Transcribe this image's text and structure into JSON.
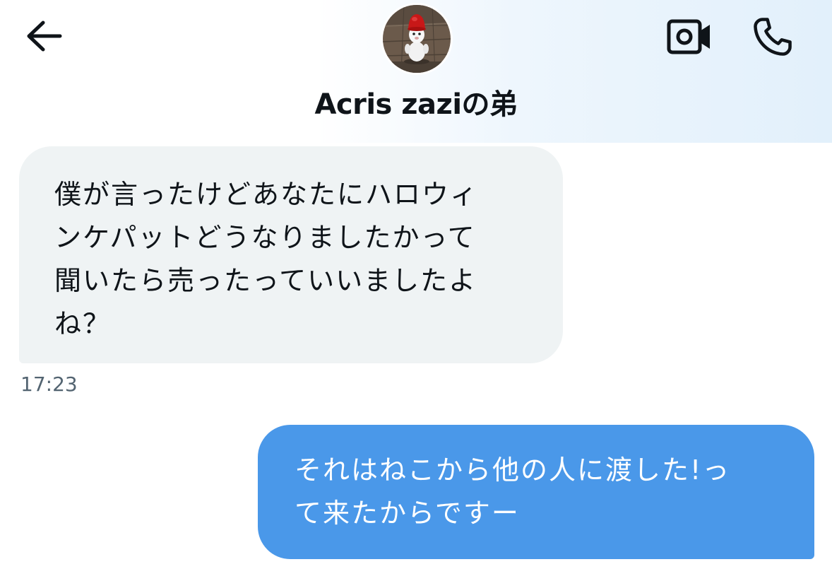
{
  "header": {
    "contact_name": "Acris zaziの弟",
    "back_icon": "arrow-left-icon",
    "video_icon": "video-camera-icon",
    "call_icon": "phone-icon"
  },
  "messages": [
    {
      "direction": "incoming",
      "text": "僕が言ったけどあなたにハロウィ\nンケパットどうなりましたかって\n聞いたら売ったっていいましたよ\nね？",
      "time": "17:23"
    },
    {
      "direction": "outgoing",
      "text": "それはねこから他の人に渡した!っ\nて来たからですー"
    }
  ],
  "colors": {
    "incoming_bubble": "#eff3f4",
    "outgoing_bubble": "#4a98e9",
    "timestamp": "#536471"
  }
}
